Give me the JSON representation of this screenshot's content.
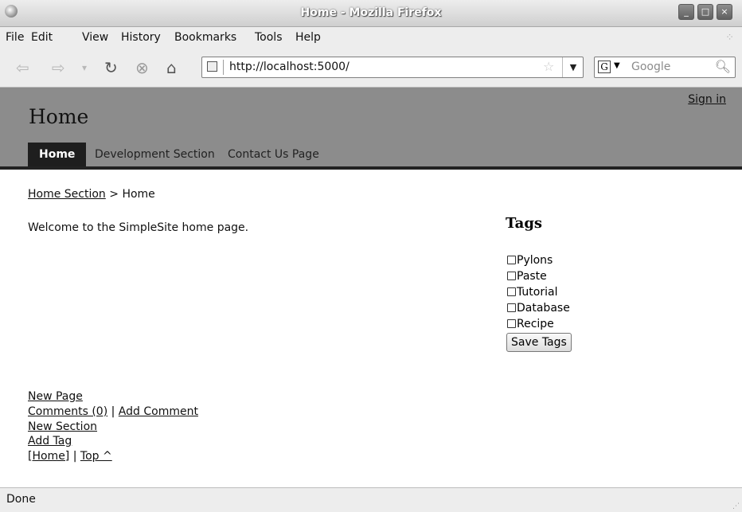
{
  "window": {
    "title": "Home - Mozilla Firefox",
    "controls": [
      "_",
      "□",
      "×"
    ]
  },
  "menubar": {
    "items": [
      "File",
      "Edit",
      "View",
      "History",
      "Bookmarks",
      "Tools",
      "Help"
    ]
  },
  "navbar": {
    "url": "http://localhost:5000/",
    "search_placeholder": "Google",
    "search_engine": "G"
  },
  "site": {
    "title": "Home",
    "signin": "Sign in",
    "tabs": [
      {
        "label": "Home",
        "active": true
      },
      {
        "label": "Development Section",
        "active": false
      },
      {
        "label": "Contact Us Page",
        "active": false
      }
    ]
  },
  "breadcrumb": {
    "link": "Home Section",
    "separator": ">",
    "current": "Home"
  },
  "main": {
    "welcome": "Welcome to the SimpleSite home page."
  },
  "tags": {
    "heading": "Tags",
    "items": [
      "Pylons",
      "Paste",
      "Tutorial",
      "Database",
      "Recipe"
    ],
    "save_label": "Save Tags"
  },
  "footer": {
    "new_page": "New Page",
    "comments": "Comments (0)",
    "sep": "|",
    "add_comment": "Add Comment",
    "new_section": "New Section",
    "add_tag": "Add Tag",
    "home": "[Home]",
    "top": "Top ^"
  },
  "status": {
    "text": "Done"
  },
  "colors": {
    "header_bg": "#8c8c8c",
    "active_tab_bg": "#1e1e1e",
    "chrome_bg": "#ededed"
  }
}
